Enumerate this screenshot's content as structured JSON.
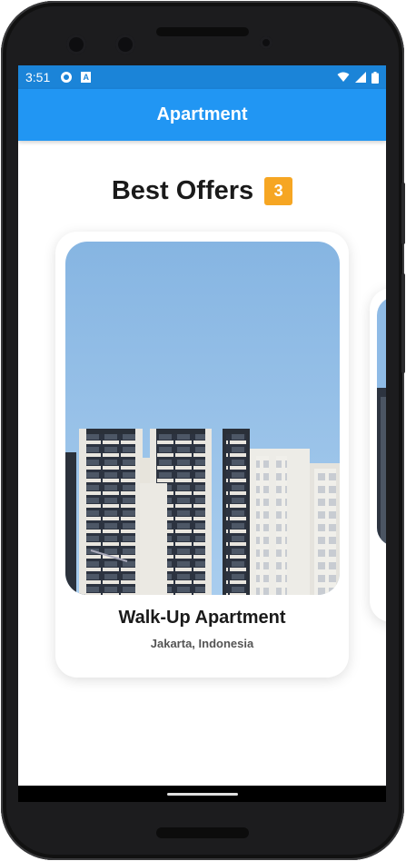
{
  "status_bar": {
    "time": "3:51",
    "icons": [
      "settings-icon",
      "a-notification-icon",
      "wifi-icon",
      "signal-icon",
      "battery-icon"
    ]
  },
  "app_bar": {
    "title": "Apartment"
  },
  "section": {
    "title": "Best Offers",
    "count": "3"
  },
  "cards": [
    {
      "title": "Walk-Up Apartment",
      "location": "Jakarta, Indonesia"
    }
  ],
  "colors": {
    "app_bar": "#2196f3",
    "status_bar": "#1b84d8",
    "badge": "#f6a623"
  }
}
